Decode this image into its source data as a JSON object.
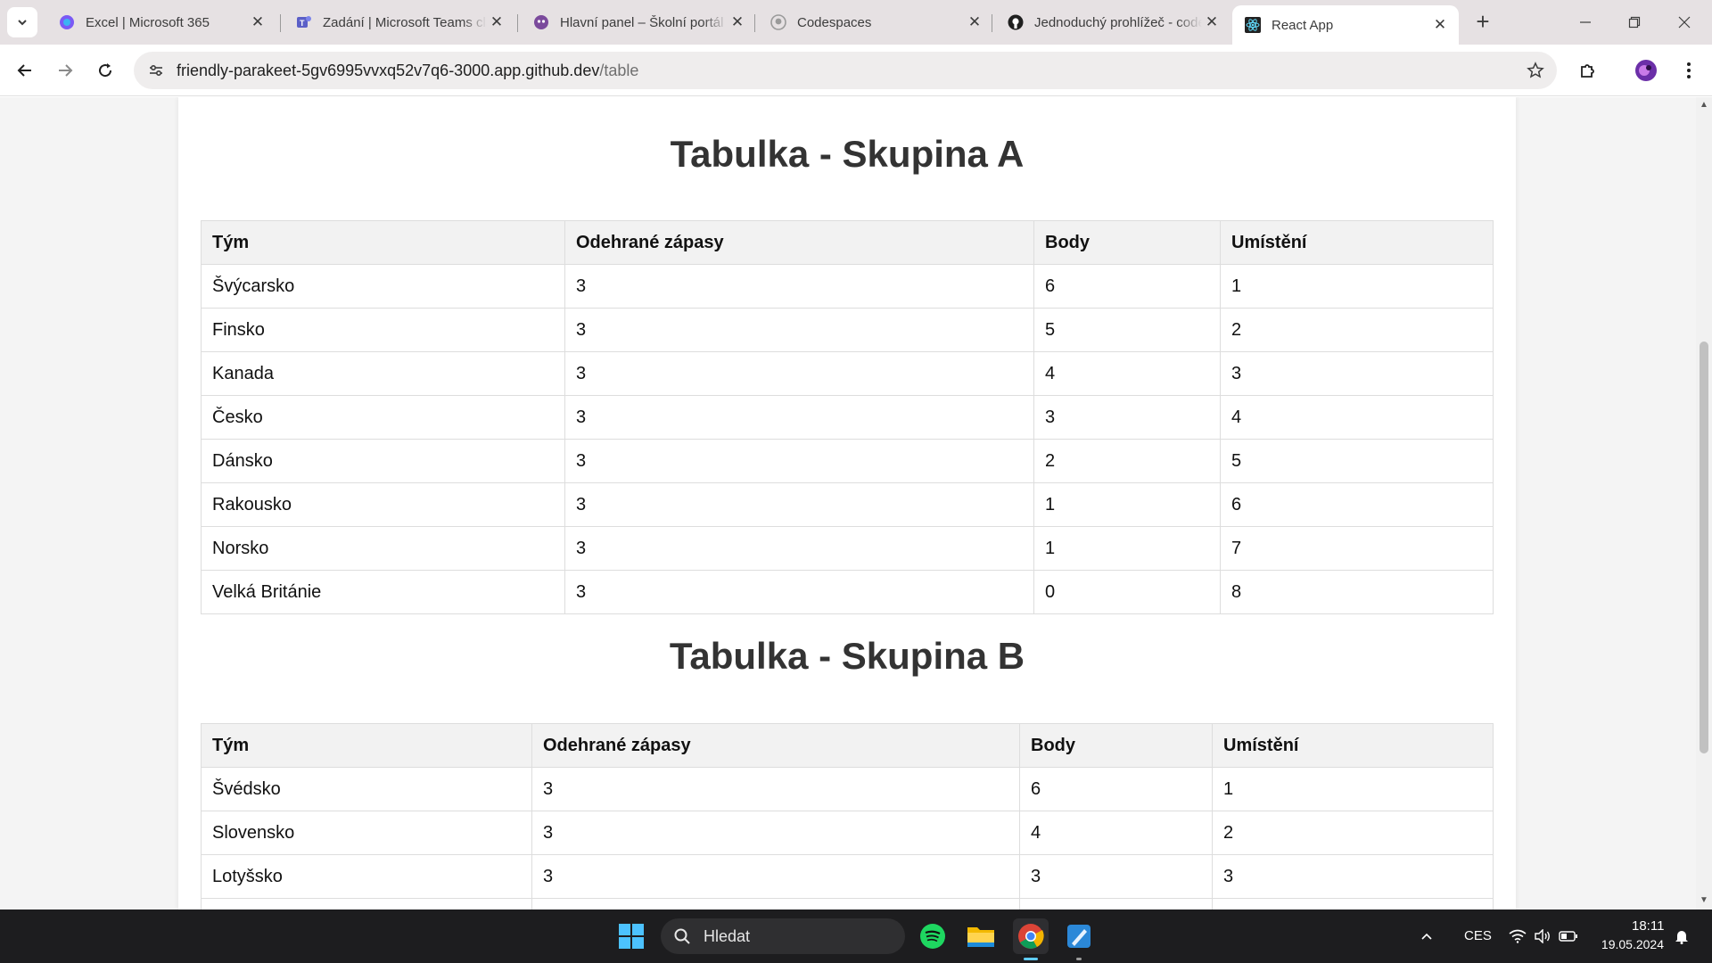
{
  "browser": {
    "tabs": [
      {
        "title": "Excel | Microsoft 365",
        "icon": "m365-icon",
        "active": false
      },
      {
        "title": "Zadání | Microsoft Teams classic",
        "icon": "teams-icon",
        "active": false
      },
      {
        "title": "Hlavní panel – Školní portál",
        "icon": "portal-icon",
        "active": false
      },
      {
        "title": "Codespaces",
        "icon": "github-icon",
        "active": false
      },
      {
        "title": "Jednoduchý prohlížeč - codespace",
        "icon": "github-icon",
        "active": false
      },
      {
        "title": "React App",
        "icon": "react-icon",
        "active": true
      }
    ],
    "address": {
      "host": "friendly-parakeet-5gv6995vvxq52v7q6-3000.app.github.dev",
      "path": "/table"
    }
  },
  "page": {
    "groups": [
      {
        "title": "Tabulka - Skupina A",
        "headers": [
          "Tým",
          "Odehrané zápasy",
          "Body",
          "Umístění"
        ],
        "rows": [
          [
            "Švýcarsko",
            "3",
            "6",
            "1"
          ],
          [
            "Finsko",
            "3",
            "5",
            "2"
          ],
          [
            "Kanada",
            "3",
            "4",
            "3"
          ],
          [
            "Česko",
            "3",
            "3",
            "4"
          ],
          [
            "Dánsko",
            "3",
            "2",
            "5"
          ],
          [
            "Rakousko",
            "3",
            "1",
            "6"
          ],
          [
            "Norsko",
            "3",
            "1",
            "7"
          ],
          [
            "Velká Británie",
            "3",
            "0",
            "8"
          ]
        ]
      },
      {
        "title": "Tabulka - Skupina B",
        "headers": [
          "Tým",
          "Odehrané zápasy",
          "Body",
          "Umístění"
        ],
        "rows": [
          [
            "Švédsko",
            "3",
            "6",
            "1"
          ],
          [
            "Slovensko",
            "3",
            "4",
            "2"
          ],
          [
            "Lotyšsko",
            "3",
            "3",
            "3"
          ],
          [
            "",
            "",
            "",
            ""
          ]
        ]
      }
    ]
  },
  "taskbar": {
    "search_placeholder": "Hledat",
    "language": "CES",
    "time": "18:11",
    "date": "19.05.2024"
  }
}
